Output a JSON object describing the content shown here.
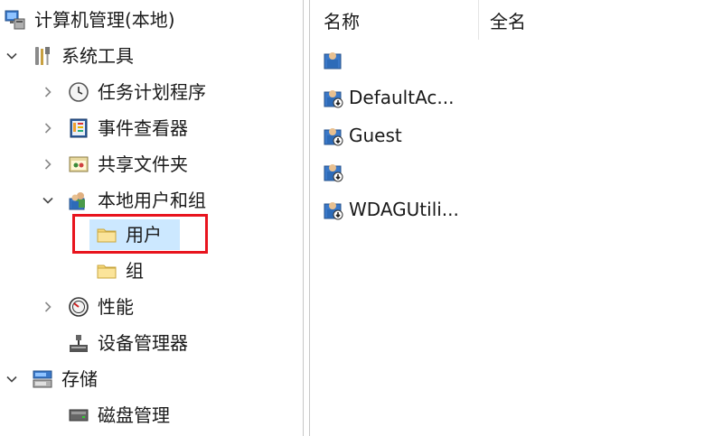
{
  "tree": {
    "root": {
      "label": "计算机管理(本地)",
      "icon": "computer-management-icon"
    },
    "system_tools": {
      "label": "系统工具",
      "icon": "tools-icon"
    },
    "task_scheduler": {
      "label": "任务计划程序",
      "icon": "clock-icon"
    },
    "event_viewer": {
      "label": "事件查看器",
      "icon": "event-viewer-icon"
    },
    "shared_folders": {
      "label": "共享文件夹",
      "icon": "shared-folder-icon"
    },
    "local_users_groups": {
      "label": "本地用户和组",
      "icon": "users-groups-icon"
    },
    "users": {
      "label": "用户",
      "icon": "folder-icon"
    },
    "groups": {
      "label": "组",
      "icon": "folder-icon"
    },
    "performance": {
      "label": "性能",
      "icon": "performance-icon"
    },
    "device_manager": {
      "label": "设备管理器",
      "icon": "device-manager-icon"
    },
    "storage": {
      "label": "存储",
      "icon": "storage-icon"
    },
    "disk_management": {
      "label": "磁盘管理",
      "icon": "disk-icon"
    }
  },
  "list": {
    "columns": {
      "name": "名称",
      "full_name": "全名"
    },
    "users": [
      {
        "name": "",
        "full_name": ""
      },
      {
        "name": "DefaultAc...",
        "full_name": ""
      },
      {
        "name": "Guest",
        "full_name": ""
      },
      {
        "name": "",
        "full_name": ""
      },
      {
        "name": "WDAGUtili...",
        "full_name": ""
      }
    ]
  },
  "colors": {
    "selection": "#cce8ff",
    "highlight_border": "#e8141e"
  }
}
